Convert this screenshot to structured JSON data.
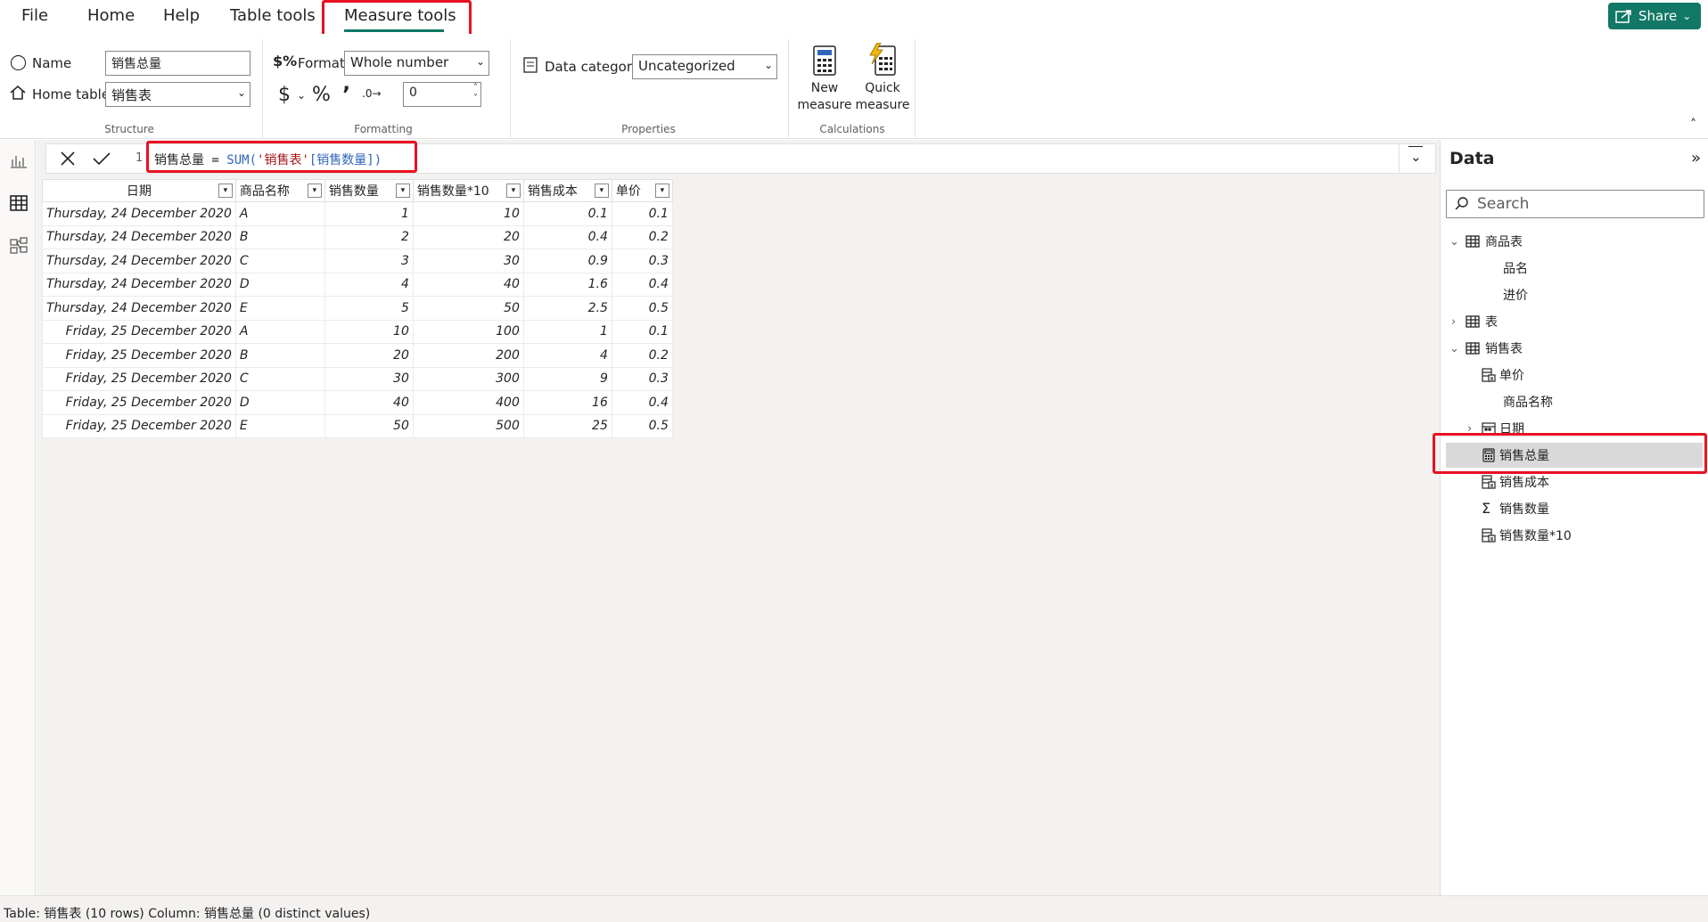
{
  "menu": {
    "file": "File",
    "home": "Home",
    "help": "Help",
    "table_tools": "Table tools",
    "measure_tools": "Measure tools",
    "share": "Share"
  },
  "ribbon": {
    "structure": {
      "title": "Structure",
      "name_label": "Name",
      "name_value": "销售总量",
      "home_table_label": "Home table",
      "home_table_value": "销售表"
    },
    "formatting": {
      "title": "Formatting",
      "format_label": "Format",
      "format_value": "Whole number",
      "decimal_value": "0"
    },
    "properties": {
      "title": "Properties",
      "data_category_label": "Data category",
      "data_category_value": "Uncategorized"
    },
    "calculations": {
      "title": "Calculations",
      "new_measure_l1": "New",
      "new_measure_l2": "measure",
      "quick_measure_l1": "Quick",
      "quick_measure_l2": "measure"
    }
  },
  "formula": {
    "line_number": "1",
    "name": "销售总量",
    "equals": " = ",
    "func": "SUM(",
    "table": "'销售表'",
    "column": "[销售数量]",
    "close": ")"
  },
  "table": {
    "columns": [
      "日期",
      "商品名称",
      "销售数量",
      "销售数量*10",
      "销售成本",
      "单价"
    ],
    "rows": [
      [
        "Thursday, 24 December 2020",
        "A",
        "1",
        "10",
        "0.1",
        "0.1"
      ],
      [
        "Thursday, 24 December 2020",
        "B",
        "2",
        "20",
        "0.4",
        "0.2"
      ],
      [
        "Thursday, 24 December 2020",
        "C",
        "3",
        "30",
        "0.9",
        "0.3"
      ],
      [
        "Thursday, 24 December 2020",
        "D",
        "4",
        "40",
        "1.6",
        "0.4"
      ],
      [
        "Thursday, 24 December 2020",
        "E",
        "5",
        "50",
        "2.5",
        "0.5"
      ],
      [
        "Friday, 25 December 2020",
        "A",
        "10",
        "100",
        "1",
        "0.1"
      ],
      [
        "Friday, 25 December 2020",
        "B",
        "20",
        "200",
        "4",
        "0.2"
      ],
      [
        "Friday, 25 December 2020",
        "C",
        "30",
        "300",
        "9",
        "0.3"
      ],
      [
        "Friday, 25 December 2020",
        "D",
        "40",
        "400",
        "16",
        "0.4"
      ],
      [
        "Friday, 25 December 2020",
        "E",
        "50",
        "500",
        "25",
        "0.5"
      ]
    ]
  },
  "data_pane": {
    "title": "Data",
    "search_placeholder": "Search",
    "tree": [
      {
        "label": "商品表",
        "kind": "table",
        "expanded": true
      },
      {
        "label": "品名",
        "kind": "field"
      },
      {
        "label": "进价",
        "kind": "field"
      },
      {
        "label": "表",
        "kind": "table",
        "expanded": false
      },
      {
        "label": "销售表",
        "kind": "table",
        "expanded": true
      },
      {
        "label": "单价",
        "kind": "calc-column"
      },
      {
        "label": "商品名称",
        "kind": "field"
      },
      {
        "label": "日期",
        "kind": "date-hierarchy"
      },
      {
        "label": "销售总量",
        "kind": "measure",
        "selected": true
      },
      {
        "label": "销售成本",
        "kind": "calc-column"
      },
      {
        "label": "销售数量",
        "kind": "sum-field"
      },
      {
        "label": "销售数量*10",
        "kind": "calc-column"
      }
    ]
  },
  "status": "Table: 销售表 (10 rows) Column: 销售总量 (0 distinct values)",
  "colors": {
    "accent": "#117865",
    "highlight_box": "#e81123",
    "selected_row": "#d9d9d9"
  }
}
